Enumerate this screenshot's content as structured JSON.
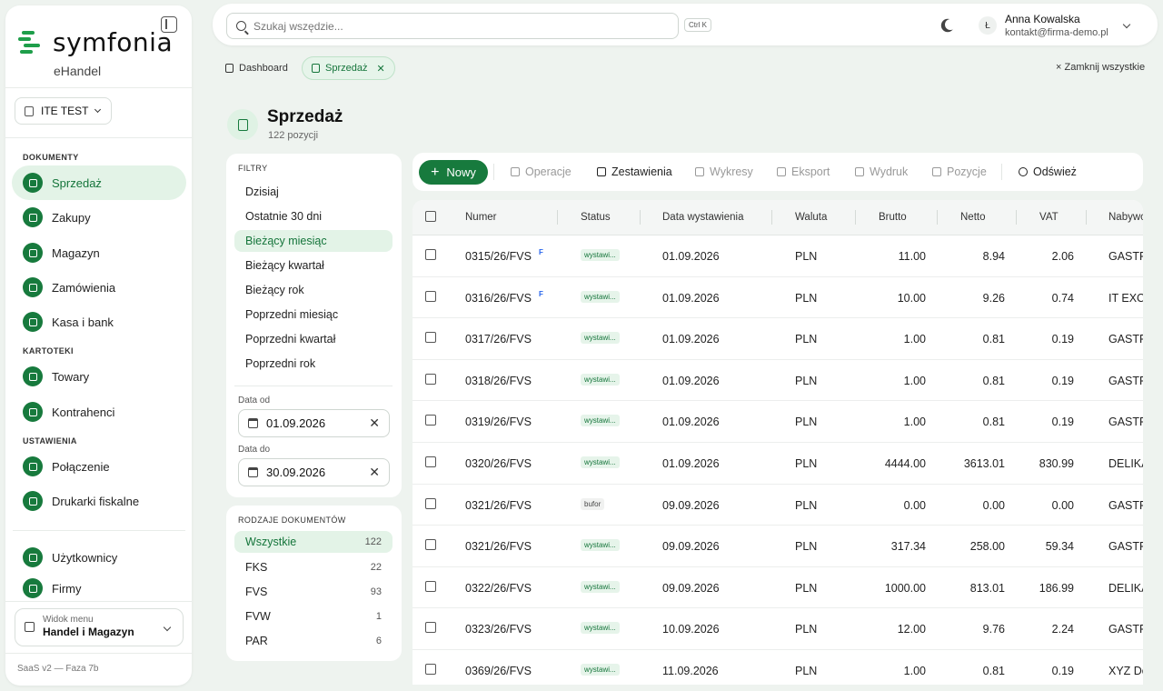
{
  "app": {
    "logo": "symfonia",
    "subtitle": "eHandel",
    "company": "ITE TEST",
    "version": "SaaS v2 — Faza 7b"
  },
  "colors": {
    "brand": "#177a3d",
    "active_bg": "#e3f3e7"
  },
  "sidebar": {
    "sections": [
      {
        "title": "DOKUMENTY"
      },
      {
        "title": "KARTOTEKI"
      },
      {
        "title": "USTAWIENIA"
      }
    ],
    "items": [
      {
        "label": "Sprzedaż",
        "icon": "invoice-icon"
      },
      {
        "label": "Zakupy",
        "icon": "cube-icon"
      },
      {
        "label": "Magazyn",
        "icon": "warehouse-icon"
      },
      {
        "label": "Zamówienia",
        "icon": "cube-icon"
      },
      {
        "label": "Kasa i bank",
        "icon": "cube-icon"
      },
      {
        "label": "Towary",
        "icon": "cube-icon"
      },
      {
        "label": "Kontrahenci",
        "icon": "users-icon"
      },
      {
        "label": "Połączenie",
        "icon": "cube-icon"
      },
      {
        "label": "Drukarki fiskalne",
        "icon": "cube-icon"
      },
      {
        "label": "Użytkownicy",
        "icon": "user-key-icon"
      },
      {
        "label": "Firmy",
        "icon": "building-icon"
      }
    ],
    "view": {
      "label": "Widok menu",
      "value": "Handel i Magazyn"
    }
  },
  "topbar": {
    "search_placeholder": "Szukaj wszędzie...",
    "shortcut": "Ctrl K",
    "user": {
      "initial": "Ł",
      "name": "Anna Kowalska",
      "email": "kontakt@firma-demo.pl"
    }
  },
  "tabs": [
    {
      "label": "Dashboard"
    },
    {
      "label": "Sprzedaż"
    }
  ],
  "close_all": "× Zamknij wszystkie",
  "page": {
    "title": "Sprzedaż",
    "subtitle": "122 pozycji"
  },
  "filters": {
    "title": "FILTRY",
    "items": [
      "Dzisiaj",
      "Ostatnie 30 dni",
      "Bieżący miesiąc",
      "Bieżący kwartał",
      "Bieżący rok",
      "Poprzedni miesiąc",
      "Poprzedni kwartał",
      "Poprzedni rok"
    ],
    "date_from_label": "Data od",
    "date_from": "01.09.2026",
    "date_to_label": "Data do",
    "date_to": "30.09.2026"
  },
  "doc_types": {
    "title": "RODZAJE DOKUMENTÓW",
    "items": [
      {
        "label": "Wszystkie",
        "count": "122"
      },
      {
        "label": "FKS",
        "count": "22"
      },
      {
        "label": "FVS",
        "count": "93"
      },
      {
        "label": "FVW",
        "count": "1"
      },
      {
        "label": "PAR",
        "count": "6"
      }
    ]
  },
  "toolbar": {
    "new": "Nowy",
    "operations": "Operacje",
    "reports": "Zestawienia",
    "charts": "Wykresy",
    "export": "Eksport",
    "print": "Wydruk",
    "positions": "Pozycje",
    "refresh": "Odśwież"
  },
  "table": {
    "columns": [
      "Numer",
      "Status",
      "Data wystawienia",
      "Waluta",
      "Brutto",
      "Netto",
      "VAT",
      "Nabywca"
    ],
    "rows": [
      {
        "numer": "0315/26/FVS",
        "f": "F",
        "status": "wystawi...",
        "data": "01.09.2026",
        "waluta": "PLN",
        "brutto": "11.00",
        "netto": "8.94",
        "vat": "2.06",
        "nabywca": "GASTRO"
      },
      {
        "numer": "0316/26/FVS",
        "f": "F",
        "status": "wystawi...",
        "data": "01.09.2026",
        "waluta": "PLN",
        "brutto": "10.00",
        "netto": "9.26",
        "vat": "0.74",
        "nabywca": "IT EXCEL"
      },
      {
        "numer": "0317/26/FVS",
        "f": "",
        "status": "wystawi...",
        "data": "01.09.2026",
        "waluta": "PLN",
        "brutto": "1.00",
        "netto": "0.81",
        "vat": "0.19",
        "nabywca": "GASTRO"
      },
      {
        "numer": "0318/26/FVS",
        "f": "",
        "status": "wystawi...",
        "data": "01.09.2026",
        "waluta": "PLN",
        "brutto": "1.00",
        "netto": "0.81",
        "vat": "0.19",
        "nabywca": "GASTRO"
      },
      {
        "numer": "0319/26/FVS",
        "f": "",
        "status": "wystawi...",
        "data": "01.09.2026",
        "waluta": "PLN",
        "brutto": "1.00",
        "netto": "0.81",
        "vat": "0.19",
        "nabywca": "GASTRO"
      },
      {
        "numer": "0320/26/FVS",
        "f": "",
        "status": "wystawi...",
        "data": "01.09.2026",
        "waluta": "PLN",
        "brutto": "4444.00",
        "netto": "3613.01",
        "vat": "830.99",
        "nabywca": "DELIKA"
      },
      {
        "numer": "0321/26/FVS",
        "f": "",
        "status": "bufor",
        "data": "09.09.2026",
        "waluta": "PLN",
        "brutto": "0.00",
        "netto": "0.00",
        "vat": "0.00",
        "nabywca": "GASTRO"
      },
      {
        "numer": "0321/26/FVS",
        "f": "",
        "status": "wystawi...",
        "data": "09.09.2026",
        "waluta": "PLN",
        "brutto": "317.34",
        "netto": "258.00",
        "vat": "59.34",
        "nabywca": "GASTRO"
      },
      {
        "numer": "0322/26/FVS",
        "f": "",
        "status": "wystawi...",
        "data": "09.09.2026",
        "waluta": "PLN",
        "brutto": "1000.00",
        "netto": "813.01",
        "vat": "186.99",
        "nabywca": "DELIKA"
      },
      {
        "numer": "0323/26/FVS",
        "f": "",
        "status": "wystawi...",
        "data": "10.09.2026",
        "waluta": "PLN",
        "brutto": "12.00",
        "netto": "9.76",
        "vat": "2.24",
        "nabywca": "GASTRO"
      },
      {
        "numer": "0369/26/FVS",
        "f": "",
        "status": "wystawi...",
        "data": "11.09.2026",
        "waluta": "PLN",
        "brutto": "1.00",
        "netto": "0.81",
        "vat": "0.19",
        "nabywca": "XYZ De"
      }
    ]
  }
}
